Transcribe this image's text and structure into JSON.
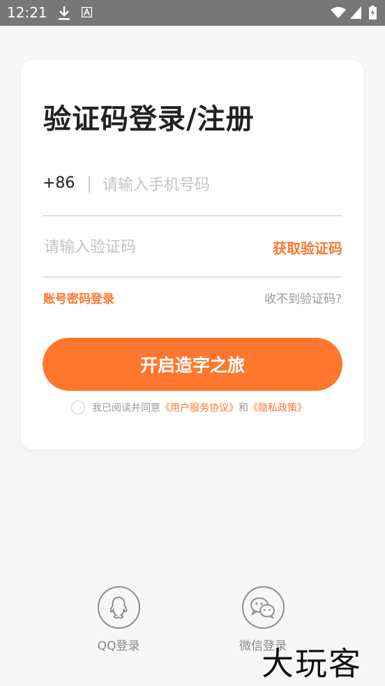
{
  "status_bar": {
    "time": "12:21"
  },
  "login": {
    "title": "验证码登录/注册",
    "country_code": "+86",
    "phone_placeholder": "请输入手机号码",
    "code_placeholder": "请输入验证码",
    "get_code": "获取验证码",
    "account_login": "账号密码登录",
    "no_code": "收不到验证码?",
    "submit": "开启造字之旅",
    "agreement": {
      "prefix": "我已阅读并同意",
      "user_agreement": "《用户服务协议》",
      "and": "和",
      "privacy": "《隐私政策》"
    }
  },
  "social": {
    "qq_label": "QQ登录",
    "wechat_label": "微信登录"
  },
  "watermark": "大玩客",
  "colors": {
    "accent": "#ff772e",
    "status_bar": "#777777",
    "background": "#f7f7f7"
  }
}
